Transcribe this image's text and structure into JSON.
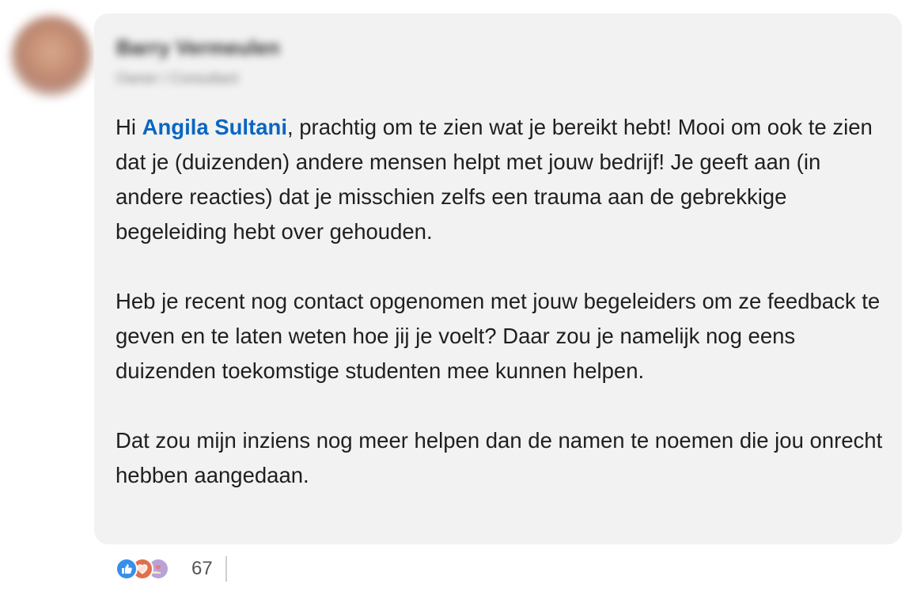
{
  "author": {
    "name": "Barry Vermeulen",
    "headline": "Owner / Consultant"
  },
  "comment": {
    "mention": "Angila Sultani",
    "p1_prefix": "Hi ",
    "p1_rest": ", prachtig om te zien wat je bereikt hebt! Mooi om ook te zien dat je (duizenden) andere mensen helpt met jouw bedrijf! Je geeft aan (in andere reacties) dat je misschien zelfs een trauma aan de gebrekkige begeleiding hebt over gehouden.",
    "p2": "Heb je recent nog contact opgenomen met jouw begeleiders om ze feedback te geven en te laten weten hoe jij je voelt? Daar zou je namelijk nog eens duizenden toekomstige studenten mee kunnen helpen.",
    "p3": "Dat zou mijn inziens nog meer helpen dan de namen te noemen die jou onrecht hebben aangedaan."
  },
  "reactions": {
    "icons": [
      "like-icon",
      "love-icon",
      "support-icon"
    ],
    "count": "67"
  },
  "colors": {
    "bubble": "#f2f2f2",
    "mention": "#0a66c2",
    "like": "#378fe9",
    "love": "#df704d",
    "support": "#b9a3d6"
  }
}
